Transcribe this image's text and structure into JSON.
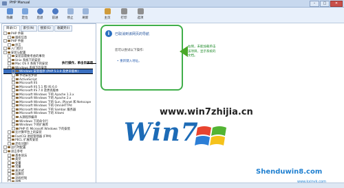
{
  "window": {
    "title": "PHP Manual",
    "min": "–",
    "max": "□",
    "close": "✕"
  },
  "toolbar": {
    "items": [
      {
        "label": "隐藏",
        "icon": "hide-icon",
        "color": "#5b8fd6"
      },
      {
        "label": "定位",
        "icon": "locate-icon",
        "color": "#7aa5dc"
      },
      {
        "label": "后退",
        "icon": "back-icon",
        "color": "#4c79c2"
      },
      {
        "label": "前进",
        "icon": "forward-icon",
        "color": "#4c79c2"
      },
      {
        "label": "停止",
        "icon": "stop-icon",
        "color": "#9ab5da"
      },
      {
        "label": "刷新",
        "icon": "refresh-icon",
        "color": "#9ab5da"
      },
      {
        "label": "主页",
        "icon": "home-icon",
        "color": "#cf9b3b"
      },
      {
        "label": "打印",
        "icon": "print-icon",
        "color": "#8f8f8f"
      },
      {
        "label": "选项",
        "icon": "options-icon",
        "color": "#8f8f8f"
      }
    ]
  },
  "nav": {
    "tabs": [
      "目录(C)",
      "索引(N)",
      "搜索(S)",
      "收藏夹(I)"
    ],
    "tree": [
      "PHP 手册",
      "版权信息",
      "PHP 手册",
      "序言",
      "入门指引",
      "安装与配置",
      "安装前需要考虑的事项",
      "Unix 系统下的安装",
      "Mac OS X 系统下的安装",
      "Windows 系统下的安装",
      "Windows 安装程序 (PHP 5.1.0 及更早版本)",
      "手动安装步骤",
      "ActiveScript",
      "Microsoft IIS",
      "Microsoft IIS 5.1 和 IIS 6.0",
      "Microsoft IIS 7.0 及更高版本",
      "Microsoft Windows 下的 Apache 1.3.x",
      "Microsoft Windows 下的 Apache 2.x",
      "Microsoft Windows 下的 Sun, iPlanet 和 Netscape",
      "Microsoft Windows 下的 OmniHTTPd",
      "Microsoft Windows 下的 Sambar 服务器",
      "Microsoft Windows 下的 Xitami",
      "从源程序编译",
      "Windows 下的命令行",
      "Windows 下的扩展库",
      "PHP 在 Microsoft Windows 下的安装",
      "云计算平台上的安装",
      "FastCGI 进程管理器 (FPM)",
      "PECL 扩展库安装",
      "还有问题?",
      "运行时配置",
      "语言参考",
      "基本语法",
      "类型",
      "变量",
      "常量",
      "表达式",
      "运算符",
      "流程控制",
      "函数"
    ],
    "selected_index": 10,
    "annotation": "执行操作，单击目录项"
  },
  "content": {
    "title": "已取消到该网页的导航",
    "subtitle": "您可以尝试以下操作:",
    "bullet": "重新键入地址。",
    "note": [
      "右侧，未能加载单击",
      "该项目，显示系统的",
      "文档。"
    ],
    "accent": "#3fae49"
  },
  "watermark": {
    "site1": "www.win7zhijia.cn",
    "logo": "Win7",
    "site2": "Shenduwin8.com",
    "site3": "www.kxinyk.com"
  }
}
